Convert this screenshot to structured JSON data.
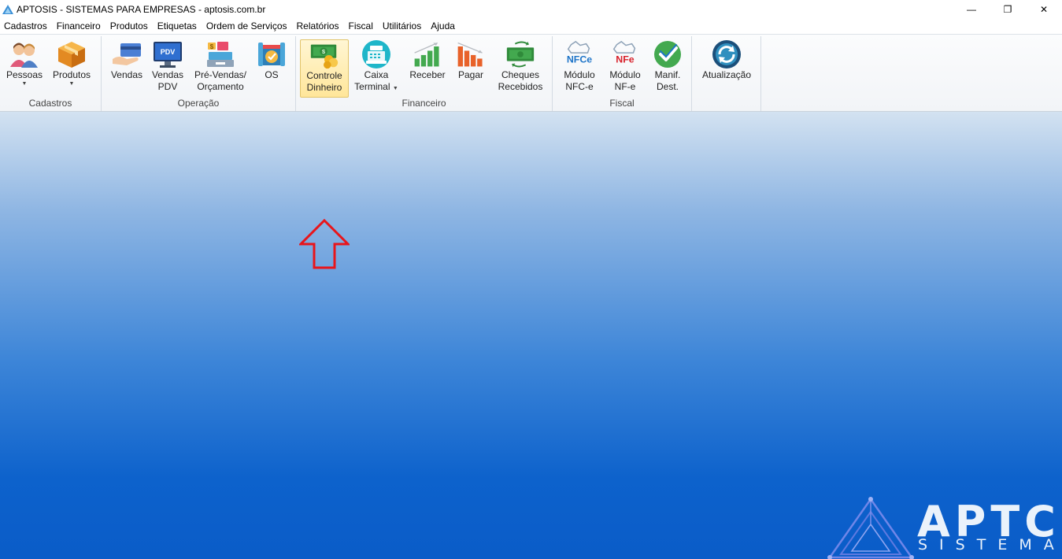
{
  "window": {
    "title": "APTOSIS - SISTEMAS PARA EMPRESAS - aptosis.com.br",
    "controls": [
      "—",
      "❐",
      "✕"
    ]
  },
  "menu": [
    "Cadastros",
    "Financeiro",
    "Produtos",
    "Etiquetas",
    "Ordem de Serviços",
    "Relatórios",
    "Fiscal",
    "Utilitários",
    "Ajuda"
  ],
  "ribbon": {
    "cadastros": {
      "label": "Cadastros",
      "pessoas": "Pessoas",
      "produtos": "Produtos"
    },
    "operacao": {
      "label": "Operação",
      "vendas": "Vendas",
      "vendas_pdv_1": "Vendas",
      "vendas_pdv_2": "PDV",
      "pdv_badge": "PDV",
      "pre_vendas_1": "Pré-Vendas/",
      "pre_vendas_2": "Orçamento",
      "os": "OS"
    },
    "financeiro": {
      "label": "Financeiro",
      "controle_1": "Controle",
      "controle_2": "Dinheiro",
      "caixa_1": "Caixa",
      "caixa_2": "Terminal",
      "receber": "Receber",
      "pagar": "Pagar",
      "cheques_1": "Cheques",
      "cheques_2": "Recebidos"
    },
    "fiscal": {
      "label": "Fiscal",
      "nfce_badge": "NFCe",
      "nfce_1": "Módulo",
      "nfce_2": "NFC-e",
      "nfe_badge": "NFe",
      "nfe_1": "Módulo",
      "nfe_2": "NF-e",
      "manif_1": "Manif.",
      "manif_2": "Dest."
    },
    "atualizacao": "Atualização"
  },
  "brand": {
    "word": "APTC",
    "sub": "SISTEMA"
  },
  "colors": {
    "highlight_arrow": "#e8151b",
    "desktop_bottom": "#0a5cc8",
    "active_button": "#ffe69a"
  }
}
